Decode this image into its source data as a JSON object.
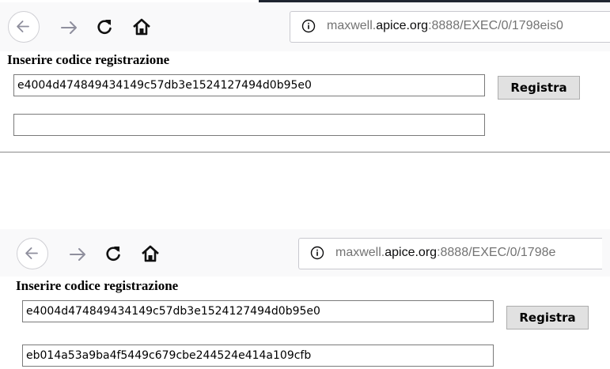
{
  "browser": {
    "url_prefix": "maxwell.",
    "url_domain": "apice.org",
    "url_suffix": ":8888/EXEC/0/1798eis0"
  },
  "browser2": {
    "url_prefix": "maxwell.",
    "url_domain": "apice.org",
    "url_suffix": ":8888/EXEC/0/1798e"
  },
  "form": {
    "title": "Inserire codice registrazione",
    "code_value": "e4004d474849434149c57db3e1524127494d0b95e0",
    "register_label": "Registra",
    "result_before": "",
    "result_after": "eb014a53a9ba4f5449c679cbe244524e414a109cfb"
  },
  "icons": [
    "back-arrow-icon",
    "forward-arrow-icon",
    "reload-icon",
    "home-icon",
    "info-icon"
  ],
  "colors": {
    "toolbar": "#f9f9fa",
    "url_muted": "#737373",
    "url_domain": "#0c0c0d",
    "button": "#e1e1e1"
  }
}
